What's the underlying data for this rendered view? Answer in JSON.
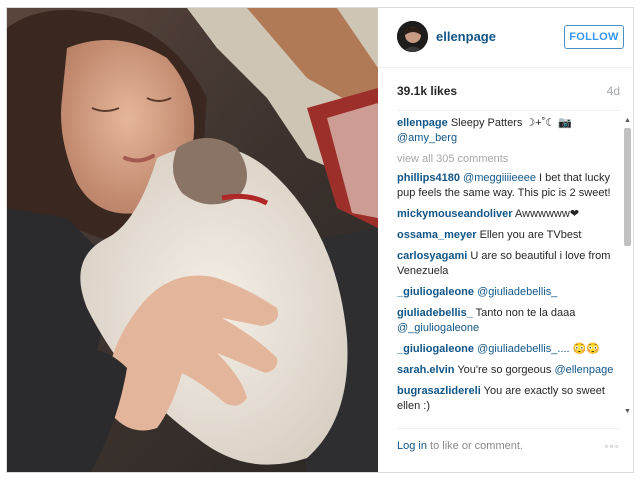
{
  "post": {
    "username": "ellenpage",
    "follow_label": "FOLLOW",
    "likes": "39.1k likes",
    "age": "4d",
    "caption": {
      "user": "ellenpage",
      "text": "Sleepy Patters ☽+˚☾ 📷",
      "mention": "@amy_berg"
    },
    "view_all": "view all 305 comments",
    "comments": [
      {
        "user": "phillips4180",
        "mention": "@meggiiiieeee",
        "text": "I bet that lucky pup feels the same way. This pic is 2 sweet!"
      },
      {
        "user": "mickymouseandoliver",
        "mention": "",
        "text": "Awwwwww❤"
      },
      {
        "user": "ossama_meyer",
        "mention": "",
        "text": "Ellen you are TVbest"
      },
      {
        "user": "carlosyagami",
        "mention": "",
        "text": "U are so beautiful i love from Venezuela"
      },
      {
        "user": "_giuliogaleone",
        "mention": "@giuliadebellis_",
        "text": ""
      },
      {
        "user": "giuliadebellis_",
        "mention": "",
        "text": "Tanto non te la daaa",
        "mention_after": "@_giuliogaleone"
      },
      {
        "user": "_giuliogaleone",
        "mention": "@giuliadebellis_....",
        "text": "😳😳"
      },
      {
        "user": "sarah.elvin",
        "mention": "",
        "text": "You're so gorgeous",
        "mention_after": "@ellenpage"
      },
      {
        "user": "bugrasazlidereli",
        "mention": "",
        "text": "You are exactly so sweet ellen :)"
      }
    ],
    "footer": {
      "login_link": "Log in",
      "login_rest": " to like or comment.",
      "more": "◦◦◦"
    }
  },
  "icons": {
    "avatar": "user-avatar",
    "more": "more-options-icon"
  }
}
